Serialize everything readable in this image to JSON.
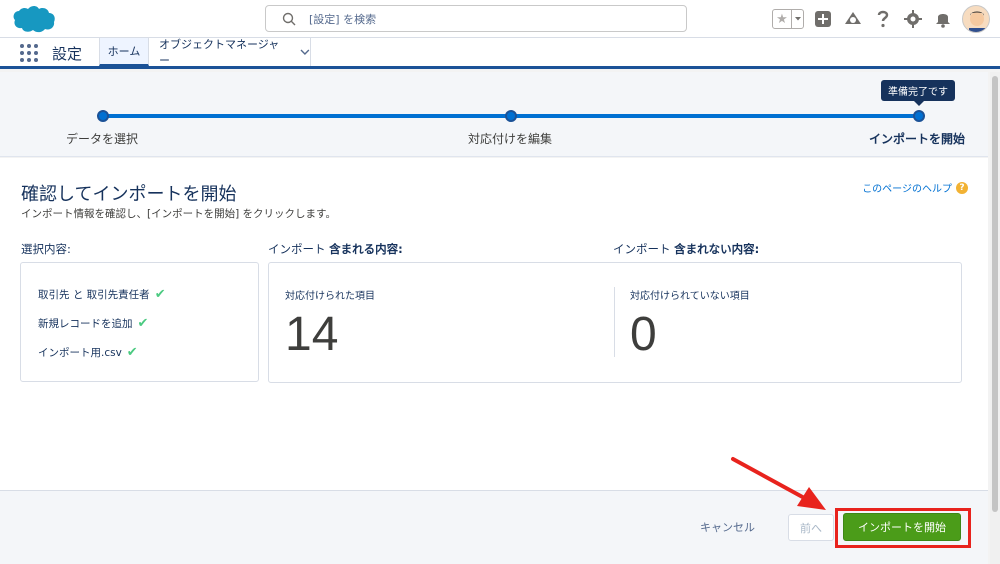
{
  "header": {
    "search_placeholder": "[設定] を検索"
  },
  "nav": {
    "app_name": "設定",
    "tabs": [
      {
        "label": "ホーム"
      },
      {
        "label": "オブジェクトマネージャー"
      }
    ]
  },
  "progress": {
    "tooltip": "準備完了です",
    "steps": [
      {
        "label": "データを選択"
      },
      {
        "label": "対応付けを編集"
      },
      {
        "label": "インポートを開始"
      }
    ]
  },
  "main": {
    "title": "確認してインポートを開始",
    "subtitle": "インポート情報を確認し、[インポートを開始] をクリックします。",
    "help_link": "このページのヘルプ",
    "selection_header": "選択内容:",
    "included_header_prefix": "インポート",
    "included_header_bold": "含まれる内容:",
    "excluded_header_prefix": "インポート",
    "excluded_header_bold": "含まれない内容:",
    "selections": [
      {
        "label": "取引先 と 取引先責任者"
      },
      {
        "label": "新規レコードを追加"
      },
      {
        "label": "インポート用.csv"
      }
    ],
    "mapped_label": "対応付けられた項目",
    "mapped_count": "14",
    "unmapped_label": "対応付けられていない項目",
    "unmapped_count": "0"
  },
  "footer": {
    "cancel_label": "キャンセル",
    "back_label": "前へ",
    "start_label": "インポートを開始"
  },
  "colors": {
    "brand_blue": "#0070d2",
    "start_green": "#4b9c19",
    "highlight_red": "#e8231d"
  }
}
